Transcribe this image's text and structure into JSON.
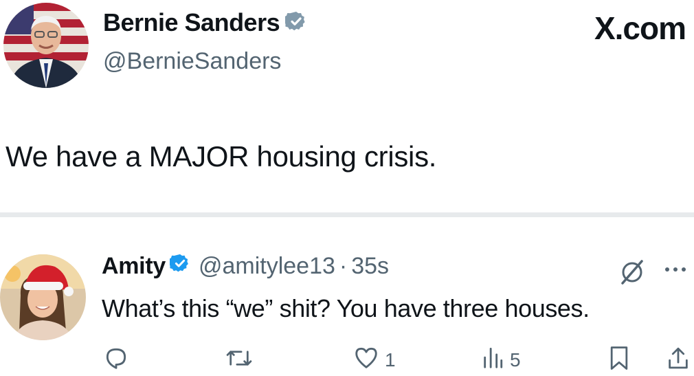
{
  "post": {
    "author": {
      "name": "Bernie Sanders",
      "handle": "@BernieSanders",
      "verified": true
    },
    "brand": "X.com",
    "text": "We have a MAJOR housing crisis."
  },
  "reply": {
    "author": {
      "name": "Amity",
      "handle": "@amitylee13",
      "verified": true
    },
    "separator": "·",
    "time": "35s",
    "text": "What’s this “we” shit? You have three houses.",
    "actions": {
      "reply_count": "",
      "repost_count": "",
      "like_count": "1",
      "views_count": "5"
    }
  },
  "icons": {
    "verified": "verified-badge-icon",
    "grok": "grok-icon",
    "more": "more-icon",
    "reply": "reply-icon",
    "repost": "repost-icon",
    "like": "heart-icon",
    "views": "views-icon",
    "bookmark": "bookmark-icon",
    "share": "share-icon"
  },
  "colors": {
    "text": "#0f1419",
    "muted": "#536471",
    "verified": "#1d9bf0",
    "divider": "#e7eaec"
  }
}
